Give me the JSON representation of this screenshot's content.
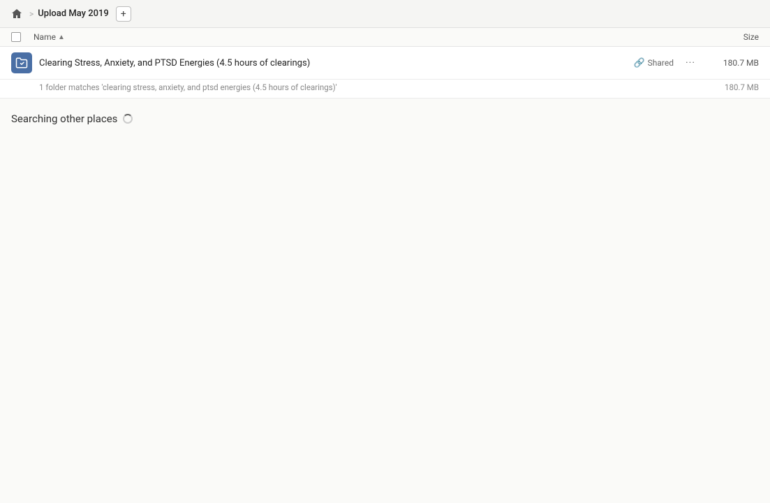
{
  "header": {
    "home_icon": "home",
    "breadcrumb_separator": ">",
    "breadcrumb_title": "Upload May 2019",
    "add_button_label": "+"
  },
  "table": {
    "name_column": "Name",
    "sort_indicator": "▲",
    "size_column": "Size"
  },
  "results": [
    {
      "icon_type": "folder-link",
      "name": "Clearing Stress, Anxiety, and PTSD Energies (4.5 hours of clearings)",
      "shared_label": "Shared",
      "more_label": "···",
      "size": "180.7 MB",
      "match_text": "1 folder matches 'clearing stress, anxiety, and ptsd energies (4.5 hours of clearings)'",
      "match_size": "180.7 MB"
    }
  ],
  "searching_section": {
    "label": "Searching other places"
  }
}
